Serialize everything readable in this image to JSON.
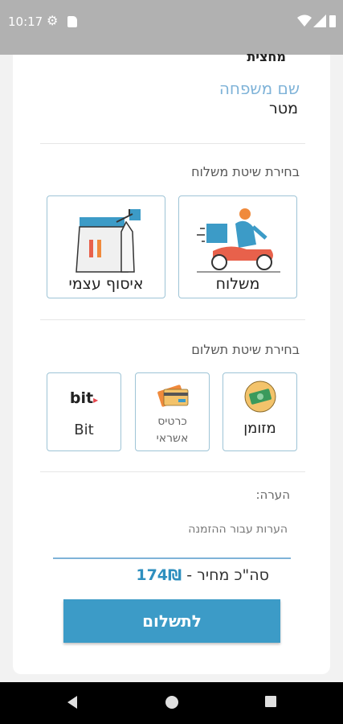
{
  "status_bar": {
    "time": "10:17"
  },
  "form": {
    "partial_top_text": "מחצית",
    "last_name_label": "שם משפחה",
    "last_name_value": "מטר"
  },
  "delivery": {
    "title": "בחירת שיטת משלוח",
    "options": [
      {
        "label": "משלוח",
        "icon": "scooter-delivery-icon"
      },
      {
        "label": "איסוף עצמי",
        "icon": "takeaway-bag-icon"
      }
    ]
  },
  "payment": {
    "title": "בחירת שיטת תשלום",
    "options": [
      {
        "label": "מזומן",
        "icon": "cash-icon"
      },
      {
        "label_line1": "כרטיס",
        "label_line2": "אשראי",
        "icon": "credit-card-icon"
      },
      {
        "logo": "bit",
        "label": "Bit",
        "icon": "bit-logo-icon"
      }
    ]
  },
  "note": {
    "label": "הערה:",
    "placeholder": "הערות עבור ההזמנה"
  },
  "total": {
    "label": "סה\"כ מחיר -",
    "amount": "174₪"
  },
  "pay_button": {
    "label": "לתשלום"
  },
  "colors": {
    "accent": "#3c9bc7",
    "label_blue": "#7fb3d8",
    "border": "#9ec4d6",
    "status_bar": "#b1b1b1"
  }
}
